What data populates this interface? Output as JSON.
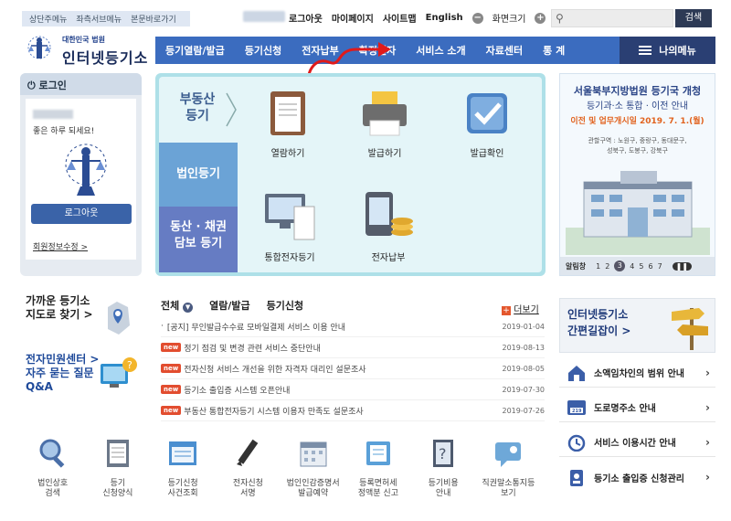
{
  "skip_links": [
    "상단주메뉴",
    "좌측서브메뉴",
    "본문바로가기"
  ],
  "top_links": {
    "logout": "로그아웃",
    "mypage": "마이페이지",
    "sitemap": "사이트맵",
    "english": "English",
    "zoom": "화면크기"
  },
  "search": {
    "placeholder": "",
    "button": "검색"
  },
  "logo": {
    "sub": "대한민국 법원",
    "main": "인터넷등기소"
  },
  "nav": [
    "등기열람/발급",
    "등기신청",
    "전자납부",
    "확정일자",
    "서비스 소개",
    "자료센터",
    "통 계"
  ],
  "my_menu": "나의메뉴",
  "login_box": {
    "title": "로그인",
    "greeting": "좋은 하루 되세요!",
    "logout_button": "로그아웃",
    "member_edit": "회원정보수정 >"
  },
  "categories": {
    "real_estate": "부동산\n등기",
    "corporate": "법인등기",
    "movable": "동산 · 채권\n담보 등기"
  },
  "services": [
    "열람하기",
    "발급하기",
    "발급확인",
    "통합전자등기",
    "전자납부"
  ],
  "banner": {
    "title": "서울북부지방법원 등기국 개청",
    "subtitle": "등기과·소 통합 · 이전 안내",
    "date": "이전 및 업무개시일  2019. 7. 1.(월)",
    "area": "관할구역 : 노원구, 중랑구, 동대문구,\n성북구, 도봉구, 강북구",
    "pager_label": "알림창",
    "pages": [
      "1",
      "2",
      "3",
      "4",
      "5",
      "6",
      "7"
    ],
    "active_page": 3
  },
  "nearby": "가까운 등기소\n지도로 찾기 >",
  "minwon": {
    "title": "전자민원센터 >",
    "faq": "자주 묻는 질문\nQ&A"
  },
  "news_tabs": [
    "전체",
    "열람/발급",
    "등기신청"
  ],
  "more": "더보기",
  "news": [
    {
      "new": false,
      "text": "[공지] 무인발급수수료 모바일결제 서비스 이용 안내",
      "date": "2019-01-04"
    },
    {
      "new": true,
      "text": "정기 점검 및 변경 관련 서비스 중단안내",
      "date": "2019-08-13"
    },
    {
      "new": true,
      "text": "전자신청 서비스 개선을 위한 자격자 대리인 설문조사",
      "date": "2019-08-05"
    },
    {
      "new": true,
      "text": "등기소 출입증 시스템 오픈안내",
      "date": "2019-07-30"
    },
    {
      "new": true,
      "text": "부동산 통합전자등기 시스템 이용자 만족도 설문조사",
      "date": "2019-07-26"
    }
  ],
  "new_badge": "new",
  "guide": {
    "line1": "인터넷등기소",
    "line2": "간편길잡이 >"
  },
  "right_links": [
    "소액임차인의 범위 안내",
    "도로명주소 안내",
    "서비스 이용시간 안내",
    "등기소 출입증 신청관리"
  ],
  "bottom_icons": [
    "법인상호\n검색",
    "등기\n신청양식",
    "등기신청\n사건조회",
    "전자신청\n서명",
    "법인인감증명서\n발급예약",
    "등록면허세\n정액분 신고",
    "등기비용\n안내",
    "직권말소통지등\n보기"
  ]
}
